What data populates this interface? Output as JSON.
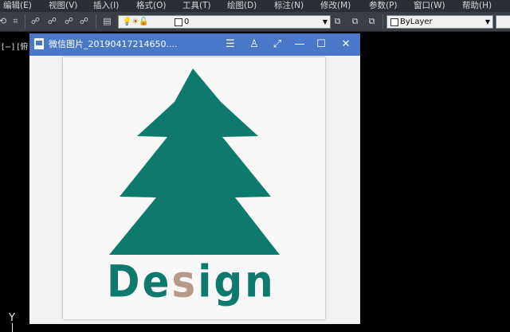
{
  "menu": {
    "items": [
      "编辑(E)",
      "视图(V)",
      "插入(I)",
      "格式(O)",
      "工具(T)",
      "绘图(D)",
      "标注(N)",
      "修改(M)",
      "参数(P)",
      "窗口(W)",
      "帮助(H)"
    ]
  },
  "toolbar": {
    "layer_value": "0",
    "linetype_value": "ByLayer"
  },
  "cad": {
    "viewport_label": "[−] [俯",
    "ucs_axis": "Y"
  },
  "viewer": {
    "title": "微信图片_20190417214650....",
    "controls": [
      "menu",
      "skin",
      "fullscreen",
      "minimize",
      "maximize",
      "close"
    ]
  },
  "image": {
    "text_main": "De",
    "text_accent": "s",
    "text_end": "ign",
    "tree_color": "#0e7a6b",
    "accent_color": "#b7998a"
  }
}
